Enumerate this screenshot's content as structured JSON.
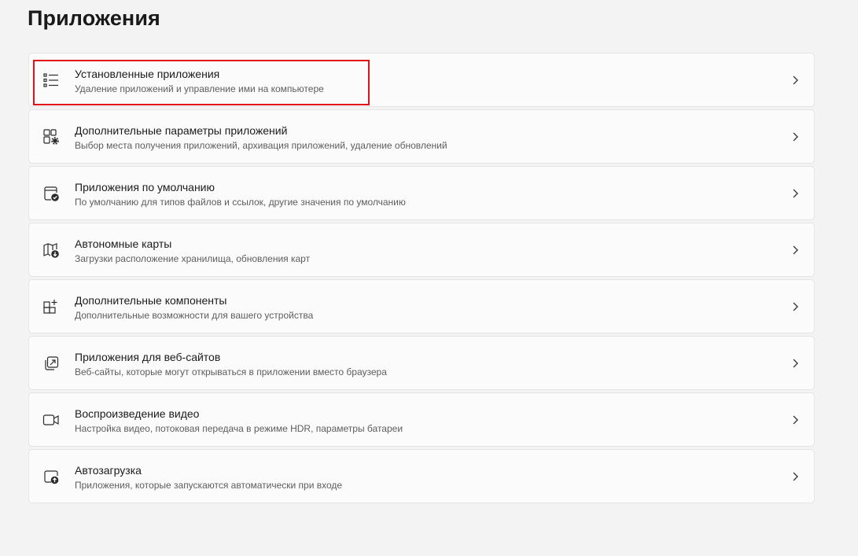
{
  "page": {
    "title": "Приложения"
  },
  "items": [
    {
      "title": "Установленные приложения",
      "description": "Удаление приложений и управление ими на компьютере",
      "icon": "installed-apps-list-icon"
    },
    {
      "title": "Дополнительные параметры приложений",
      "description": "Выбор места получения приложений, архивация приложений, удаление обновлений",
      "icon": "apps-settings-gear-icon"
    },
    {
      "title": "Приложения по умолчанию",
      "description": "По умолчанию для типов файлов и ссылок, другие значения по умолчанию",
      "icon": "default-apps-check-icon"
    },
    {
      "title": "Автономные карты",
      "description": "Загрузки расположение хранилища, обновления карт",
      "icon": "offline-map-download-icon"
    },
    {
      "title": "Дополнительные компоненты",
      "description": "Дополнительные возможности для вашего устройства",
      "icon": "optional-features-add-icon"
    },
    {
      "title": "Приложения для веб-сайтов",
      "description": "Веб-сайты, которые могут открываться в приложении вместо браузера",
      "icon": "web-app-open-icon"
    },
    {
      "title": "Воспроизведение видео",
      "description": "Настройка видео, потоковая передача в режиме HDR, параметры батареи",
      "icon": "video-camera-icon"
    },
    {
      "title": "Автозагрузка",
      "description": "Приложения, которые запускаются автоматически при входе",
      "icon": "startup-arrow-icon"
    }
  ],
  "colors": {
    "background": "#f3f3f3",
    "card": "#fbfbfb",
    "highlight": "#e0101a"
  }
}
